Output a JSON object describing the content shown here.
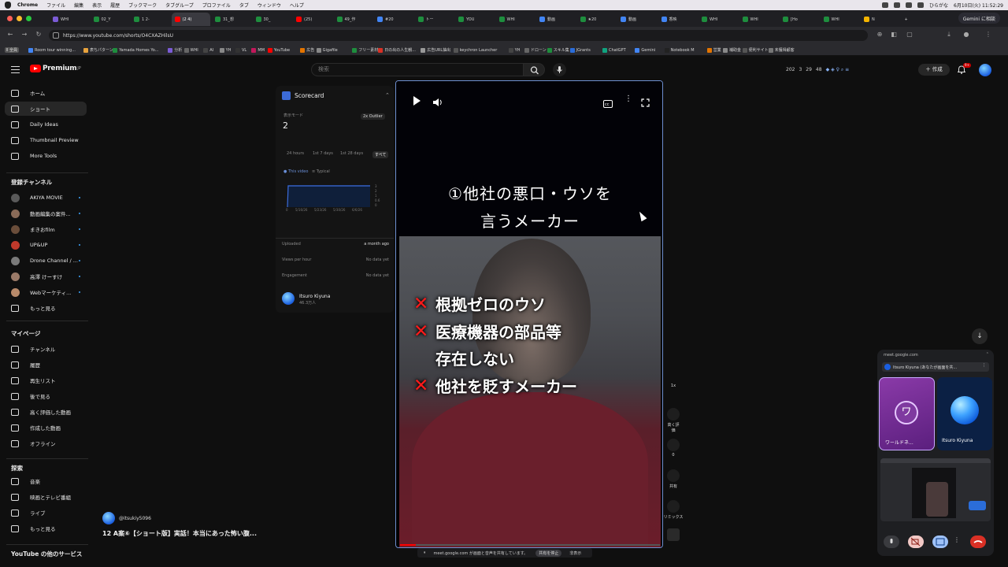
{
  "menubar": {
    "app": "Chrome",
    "items": [
      "ファイル",
      "編集",
      "表示",
      "履歴",
      "ブックマーク",
      "タブグループ",
      "プロファイル",
      "タブ",
      "ウィンドウ",
      "ヘルプ"
    ],
    "clock": "6月10日(火) 11:52:29",
    "user": "ひらがな"
  },
  "tabs": [
    {
      "label": "WHI",
      "color": "#7b5bd6"
    },
    {
      "label": "02_Y",
      "color": "#1e8e3e"
    },
    {
      "label": "1 2-",
      "color": "#1e8e3e"
    },
    {
      "label": "(2 4)",
      "color": "#ff0000"
    },
    {
      "label": "31_想",
      "color": "#1e8e3e"
    },
    {
      "label": "30_",
      "color": "#1e8e3e"
    },
    {
      "label": "(25)",
      "color": "#ff0000"
    },
    {
      "label": "49_作",
      "color": "#1e8e3e"
    },
    {
      "label": "#20",
      "color": "#4285f4"
    },
    {
      "label": "トー",
      "color": "#1e8e3e"
    },
    {
      "label": "YOU",
      "color": "#1e8e3e"
    },
    {
      "label": "WHI",
      "color": "#1e8e3e"
    },
    {
      "label": "動画",
      "color": "#4285f4"
    },
    {
      "label": "★20",
      "color": "#1e8e3e"
    },
    {
      "label": "動画",
      "color": "#4285f4"
    },
    {
      "label": "香映",
      "color": "#4285f4"
    },
    {
      "label": "WHI",
      "color": "#1e8e3e"
    },
    {
      "label": "WHI",
      "color": "#1e8e3e"
    },
    {
      "label": "[Ho",
      "color": "#1e8e3e"
    },
    {
      "label": "WHI",
      "color": "#1e8e3e"
    },
    {
      "label": "N",
      "color": "#f4b400"
    }
  ],
  "gemini_button": "Gemini に相談",
  "url": "https://www.youtube.com/shorts/O4CXAZHilsU",
  "bookmarks": [
    "Room tour winning...",
    "表ちパターン",
    "Yamada Homes Yo...",
    "分析",
    "WHI",
    "AI",
    "YH",
    "VL",
    "MM",
    "YouTube",
    "広告",
    "Gigafile",
    "フリー素材",
    "日の出の人生観...",
    "広告URL抽出",
    "keychron Launcher",
    "YH",
    "ドローン",
    "スキル集",
    "JGrants",
    "ChatGPT",
    "Gemini",
    "Notebook M",
    "営業",
    "補助金",
    "便利サイト",
    "未獲得顧客"
  ],
  "bookmark_first": "Ⅱ 全員",
  "youtube": {
    "logo": "Premium",
    "logo_region": "JP",
    "search_placeholder": "検索",
    "stats": [
      "202",
      "3",
      "29",
      "48"
    ],
    "create": "作成",
    "notif_count": "9+"
  },
  "sidebar": {
    "top": [
      {
        "label": "ホーム",
        "icon": "home-icon"
      },
      {
        "label": "ショート",
        "icon": "shorts-icon",
        "active": true
      },
      {
        "label": "Daily Ideas",
        "icon": "ideas-icon"
      },
      {
        "label": "Thumbnail Preview",
        "icon": "preview-icon"
      },
      {
        "label": "More Tools",
        "icon": "tools-icon"
      }
    ],
    "subs_heading": "登録チャンネル",
    "subs": [
      {
        "label": "AKIYA MOVIE",
        "color": "#5a5a5a"
      },
      {
        "label": "動画編集の案件...",
        "color": "#8a6b58"
      },
      {
        "label": "まきおfilm",
        "color": "#6a4d3a"
      },
      {
        "label": "UP&UP",
        "color": "#c0392b"
      },
      {
        "label": "Drone Channel / ...",
        "color": "#7a7a7a"
      },
      {
        "label": "高澤 けーすけ",
        "color": "#9a7a68"
      },
      {
        "label": "Webマーケティ...",
        "color": "#b88a6a"
      }
    ],
    "more": "もっと見る",
    "my_heading": "マイページ",
    "my": [
      {
        "label": "チャンネル",
        "icon": "channel-icon"
      },
      {
        "label": "履歴",
        "icon": "history-icon"
      },
      {
        "label": "再生リスト",
        "icon": "playlist-icon"
      },
      {
        "label": "後で見る",
        "icon": "watch-later-icon"
      },
      {
        "label": "高く評価した動画",
        "icon": "like-icon"
      },
      {
        "label": "作成した動画",
        "icon": "your-videos-icon"
      },
      {
        "label": "オフライン",
        "icon": "download-icon"
      }
    ],
    "explore_heading": "探索",
    "explore": [
      {
        "label": "音楽",
        "icon": "music-icon"
      },
      {
        "label": "映画とテレビ番組",
        "icon": "movies-icon"
      },
      {
        "label": "ライブ",
        "icon": "live-icon"
      },
      {
        "label": "もっと見る",
        "icon": "chevron-down-icon"
      }
    ],
    "other_heading": "YouTube の他のサービス"
  },
  "scorecard": {
    "title": "Scorecard",
    "mode_label": "表示モード",
    "mode_value": "2",
    "outlier": "2x Outlier",
    "ranges": [
      "24 hours",
      "1st 7 days",
      "1st 28 days",
      "すべて"
    ],
    "legend": [
      "This video",
      "Typical"
    ],
    "yticks": [
      "3",
      "2",
      "1",
      "0.6",
      "0"
    ],
    "xticks": [
      "0",
      "5/16/26",
      "5/23/26",
      "5/30/26",
      "6/6/26"
    ],
    "uploaded_label": "Uploaded",
    "uploaded_value": "a month ago",
    "vph_label": "Views per hour",
    "vph_value": "No data yet",
    "engagement_label": "Engagement",
    "engagement_value": "No data yet",
    "channel_name": "Itsuro Kiyuna",
    "channel_subs": "46.3万人",
    "accent": "#3c6bd8"
  },
  "video": {
    "caption_top": [
      "①他社の悪口・ウソを",
      "言うメーカー"
    ],
    "bullets": [
      {
        "x": true,
        "text": "根拠ゼロのウソ"
      },
      {
        "x": true,
        "text": "医療機器の部品等"
      },
      {
        "x": false,
        "text": "存在しない"
      },
      {
        "x": true,
        "text": "他社を貶すメーカー"
      }
    ],
    "progress_fraction": 0.06
  },
  "rail": {
    "speed": "1x",
    "like_label": "高く評価",
    "comment_count": "0",
    "share_label": "共有",
    "remix_label": "リミックス"
  },
  "meet": {
    "url": "meet.google.com",
    "bar_text": "Itsuro Kiyuna (あなたが画面を共...",
    "tile1_letter": "ワ",
    "tile1_name": "ワールドネ...",
    "tile2_name": "Itsuro Kiyuna"
  },
  "sharebar": {
    "text": "meet.google.com が画面と音声を共有しています。",
    "stop": "共有を停止",
    "hide": "非表示"
  },
  "channel_footer": {
    "handle": "@itsukiy5096",
    "title": "12 A案⑥【ショート版】実話！本当にあった怖い腹..."
  }
}
